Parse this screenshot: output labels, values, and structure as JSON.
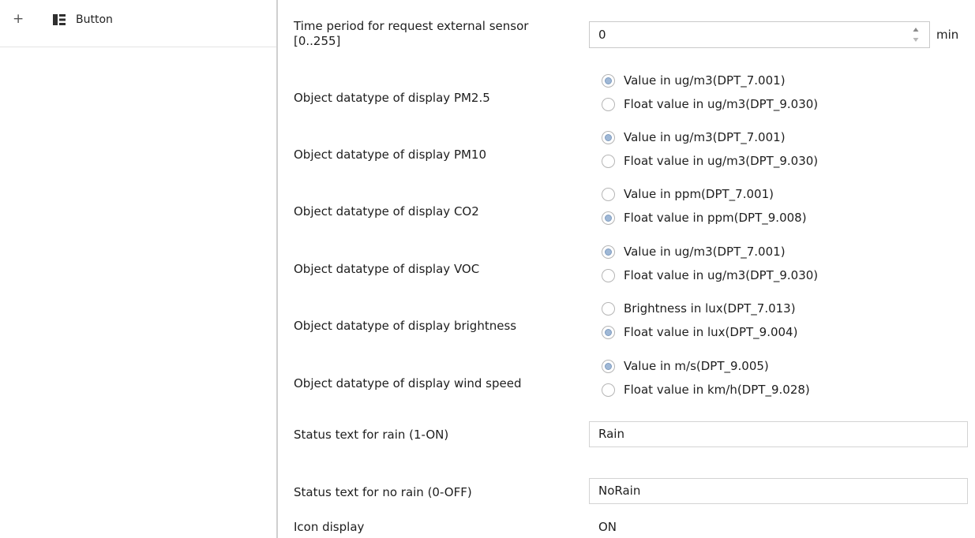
{
  "sidebar": {
    "item_label": "Button"
  },
  "params": {
    "external_sensor": {
      "label_line1": "Time period for request external sensor",
      "label_line2": "[0..255]",
      "value": "0",
      "unit": "min"
    },
    "pm25": {
      "label": "Object datatype of display PM2.5",
      "options": [
        "Value in ug/m3(DPT_7.001)",
        "Float value in ug/m3(DPT_9.030)"
      ],
      "selected": 0
    },
    "pm10": {
      "label": "Object datatype of display PM10",
      "options": [
        "Value in ug/m3(DPT_7.001)",
        "Float value in ug/m3(DPT_9.030)"
      ],
      "selected": 0
    },
    "co2": {
      "label": "Object datatype of display CO2",
      "options": [
        "Value in ppm(DPT_7.001)",
        "Float value in ppm(DPT_9.008)"
      ],
      "selected": 1
    },
    "voc": {
      "label": "Object datatype of display VOC",
      "options": [
        "Value in ug/m3(DPT_7.001)",
        "Float value in ug/m3(DPT_9.030)"
      ],
      "selected": 0
    },
    "brightness": {
      "label": "Object datatype of display brightness",
      "options": [
        "Brightness in lux(DPT_7.013)",
        "Float value in lux(DPT_9.004)"
      ],
      "selected": 1
    },
    "wind": {
      "label": "Object datatype of display wind speed",
      "options": [
        "Value in m/s(DPT_9.005)",
        "Float value in km/h(DPT_9.028)"
      ],
      "selected": 0
    },
    "rain_on": {
      "label": "Status text for rain (1-ON)",
      "value": "Rain"
    },
    "rain_off": {
      "label": "Status text for no rain (0-OFF)",
      "value": "NoRain"
    },
    "icon_display": {
      "label": "Icon display",
      "value": "ON"
    }
  },
  "colors": {
    "radio_selected": "#9fb8d6",
    "divider": "#cfcfcf"
  }
}
